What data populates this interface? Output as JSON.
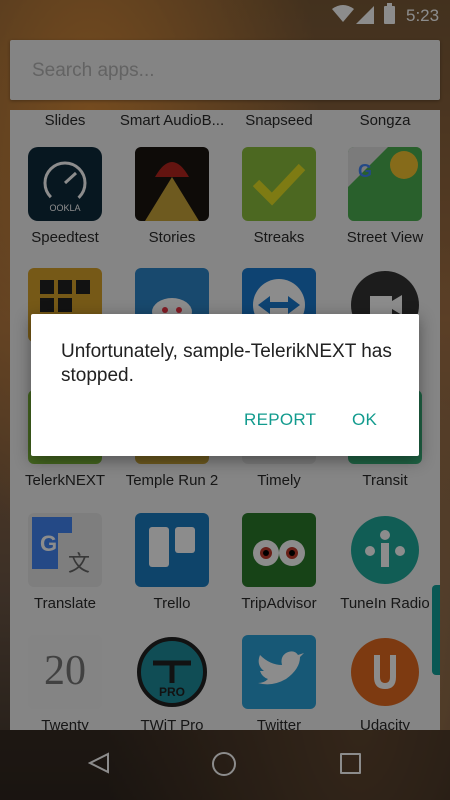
{
  "status_bar": {
    "time": "5:23",
    "icons": [
      "wifi-icon",
      "cell-signal-icon",
      "battery-icon"
    ]
  },
  "search": {
    "placeholder": "Search apps..."
  },
  "app_grid": {
    "rows": [
      [
        {
          "label": "Slides",
          "icon": "slides-icon"
        },
        {
          "label": "Smart AudioB...",
          "icon": "smart-audiobook-icon"
        },
        {
          "label": "Snapseed",
          "icon": "snapseed-icon"
        },
        {
          "label": "Songza",
          "icon": "songza-icon"
        }
      ],
      [
        {
          "label": "Speedtest",
          "icon": "speedtest-icon"
        },
        {
          "label": "Stories",
          "icon": "stories-icon"
        },
        {
          "label": "Streaks",
          "icon": "streaks-icon"
        },
        {
          "label": "Street View",
          "icon": "street-view-icon"
        }
      ],
      [
        {
          "label": "",
          "icon": "grid-app-icon"
        },
        {
          "label": "",
          "icon": "reddit-app-icon"
        },
        {
          "label": "",
          "icon": "teamviewer-icon"
        },
        {
          "label": "",
          "icon": "video-camera-icon"
        }
      ],
      [
        {
          "label": "TelerkNEXT",
          "icon": "teleriknext-icon"
        },
        {
          "label": "Temple Run 2",
          "icon": "temple-run-icon"
        },
        {
          "label": "Timely",
          "icon": "timely-icon"
        },
        {
          "label": "Transit",
          "icon": "transit-icon"
        }
      ],
      [
        {
          "label": "Translate",
          "icon": "translate-icon"
        },
        {
          "label": "Trello",
          "icon": "trello-icon"
        },
        {
          "label": "TripAdvisor",
          "icon": "tripadvisor-icon"
        },
        {
          "label": "TuneIn Radio",
          "icon": "tunein-icon"
        }
      ],
      [
        {
          "label": "Twenty",
          "icon": "twenty-icon"
        },
        {
          "label": "TWiT Pro",
          "icon": "twit-pro-icon"
        },
        {
          "label": "Twitter",
          "icon": "twitter-icon"
        },
        {
          "label": "Udacity",
          "icon": "udacity-icon"
        }
      ]
    ],
    "icon_text": {
      "speedtest": "OOKLA",
      "twenty": "20",
      "twit_pro": "PRO"
    }
  },
  "dialog": {
    "message": "Unfortunately, sample-TelerikNEXT has stopped.",
    "report_label": "REPORT",
    "ok_label": "OK",
    "accent_color": "#129b8e"
  },
  "nav_bar": {
    "buttons": [
      "back-icon",
      "home-icon",
      "recents-icon"
    ]
  }
}
